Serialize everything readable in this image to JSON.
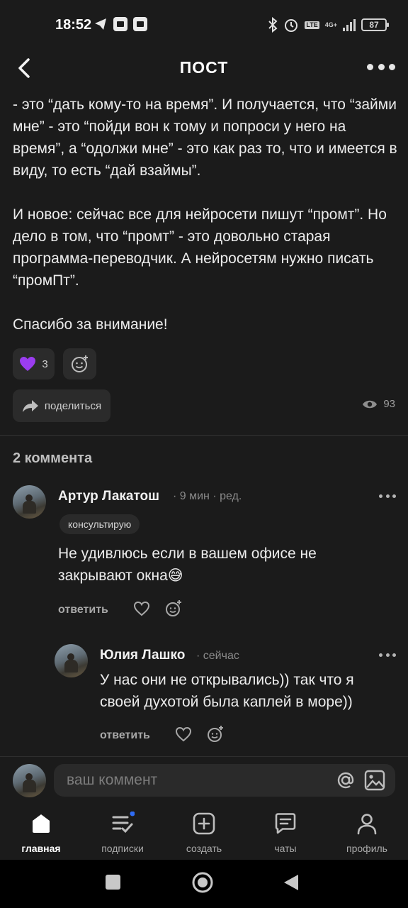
{
  "status_bar": {
    "time": "18:52",
    "battery": "87",
    "network": "4G+",
    "lte": "LTE"
  },
  "header": {
    "title": "ПОСТ"
  },
  "post": {
    "paragraphs": [
      "- это “дать кому-то на время”. И получается, что “займи мне” - это “пойди вон к тому и попроси у него на время”, а “одолжи мне” - это как раз то, что и имеется в виду, то есть “дай взаймы”.",
      "И новое: сейчас все для нейросети пишут “промт”. Но дело в том, что “промт” - это довольно старая программа-переводчик. А нейросетям нужно писать “промПт”.",
      "Спасибо за внимание!"
    ],
    "reaction_count": "3",
    "share_label": "поделиться",
    "views": "93"
  },
  "comments": {
    "count_label": "2 коммента",
    "items": [
      {
        "author": "Артур Лакатош",
        "meta": "· 9 мин · ред.",
        "badge": "консультирую",
        "text": "Не удивлюсь если в вашем офисе не закрывают окна😅",
        "reply_label": "ответить"
      },
      {
        "author": "Юлия Лашко",
        "meta": "· сейчас",
        "text": "У нас они не открывались)) так что я своей духотой была каплей в море))",
        "reply_label": "ответить"
      }
    ]
  },
  "comment_input": {
    "placeholder": "ваш коммент"
  },
  "bottom_nav": [
    {
      "label": "главная",
      "icon": "home-icon",
      "active": true
    },
    {
      "label": "подписки",
      "icon": "subscriptions-icon",
      "active": false
    },
    {
      "label": "создать",
      "icon": "create-icon",
      "active": false
    },
    {
      "label": "чаты",
      "icon": "chat-icon",
      "active": false
    },
    {
      "label": "профиль",
      "icon": "profile-icon",
      "active": false
    }
  ],
  "colors": {
    "background": "#1b1b1b",
    "surface": "#2b2b2b",
    "reaction_heart": "#9b3df0",
    "notification_dot": "#2f6cf5"
  }
}
